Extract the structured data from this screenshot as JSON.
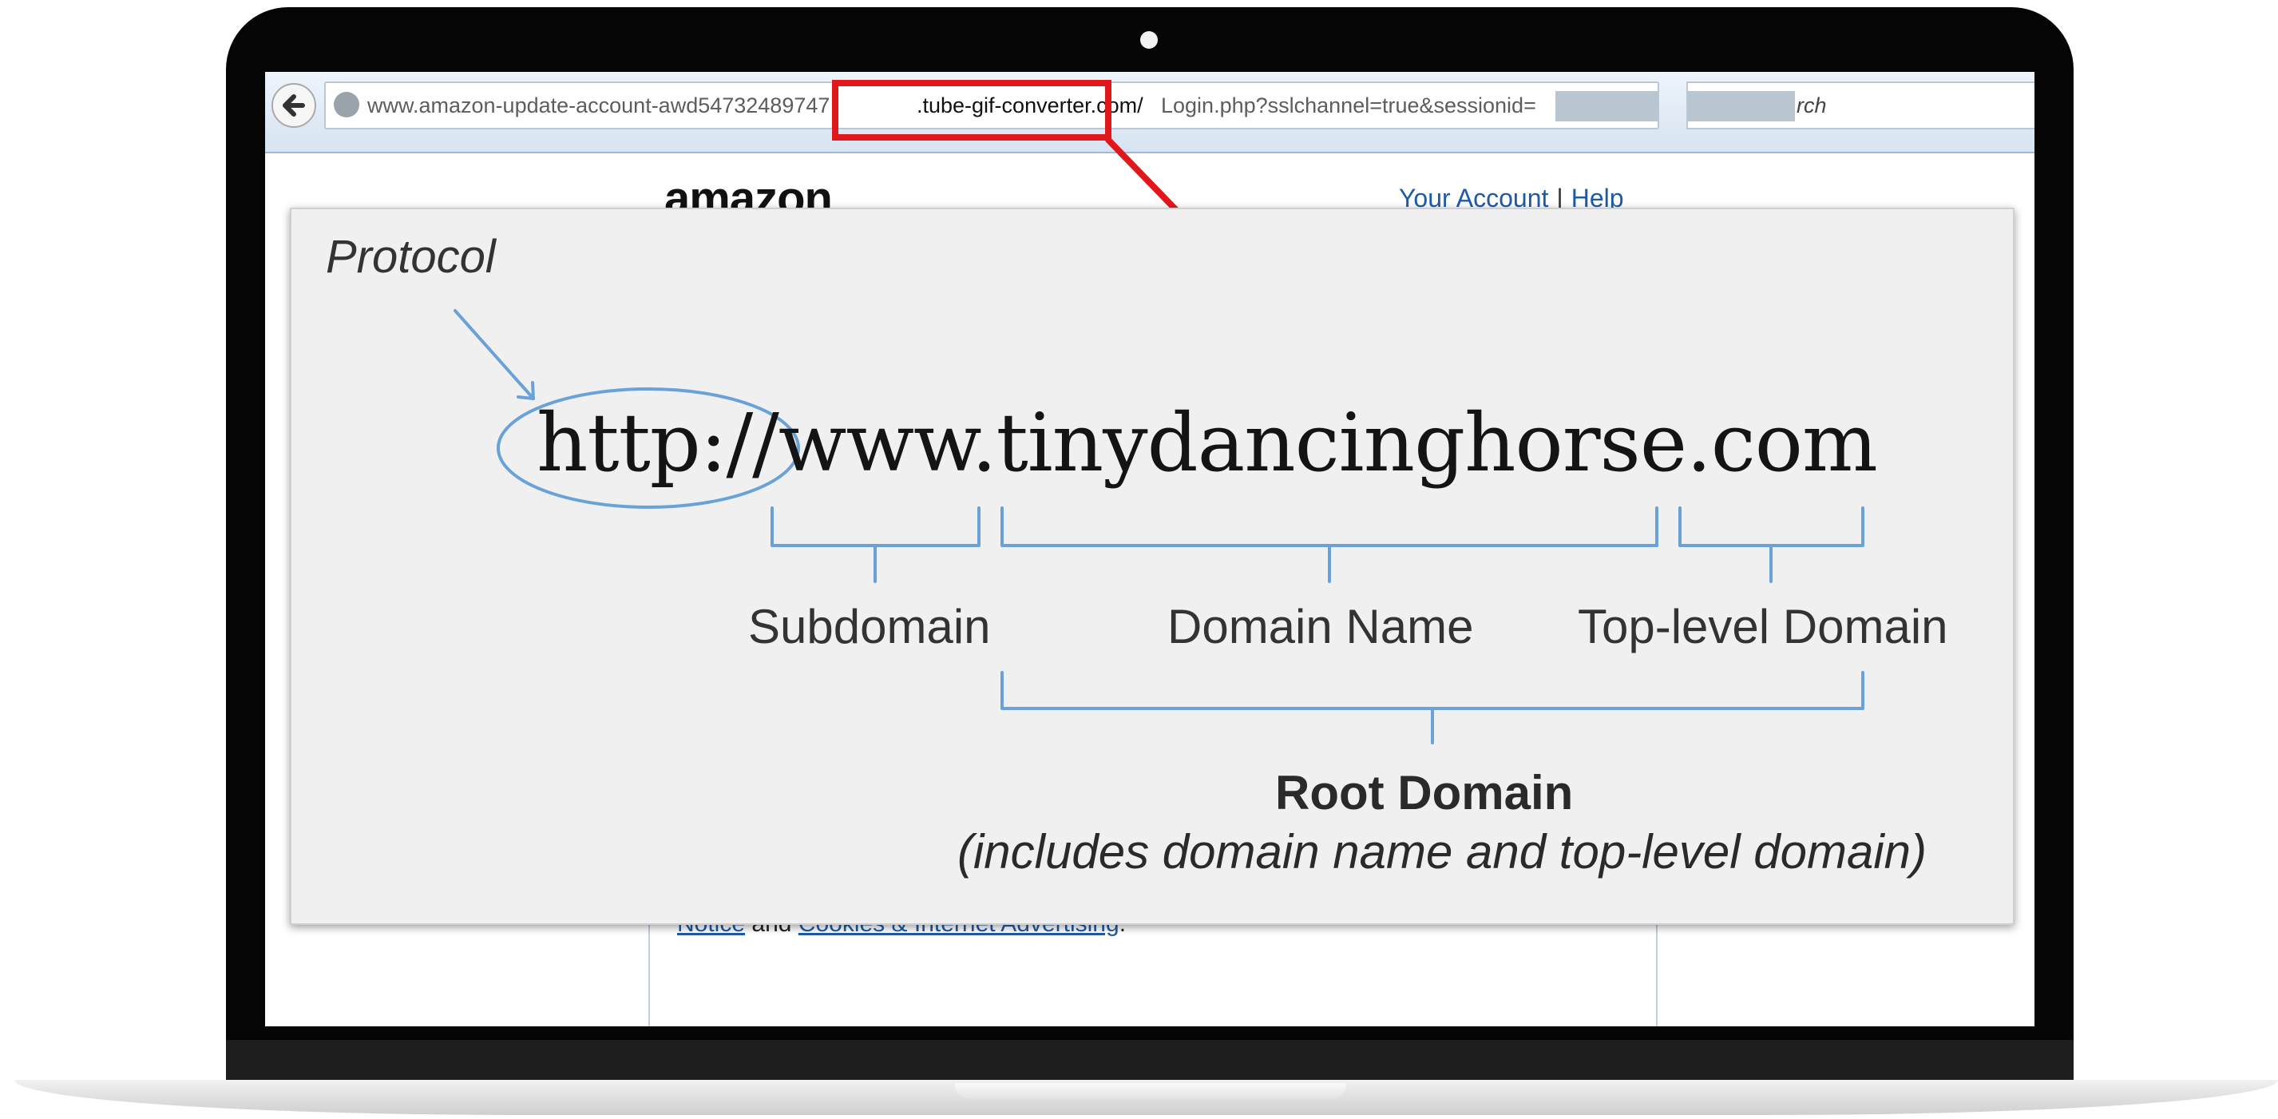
{
  "browser": {
    "url_prefix": "www.amazon-update-account-awd54732489747",
    "url_highlight": ".tube-gif-converter.com/",
    "url_suffix": "Login.php?sslchannel=true&sessionid=",
    "search_text": "rch"
  },
  "page": {
    "logo_text": "amazon",
    "account_link": "Your Account",
    "account_separator": "|",
    "help_link": "Help",
    "privacy_link": "Notice",
    "privacy_and": "and",
    "cookies_link": "Cookies & Internet Advertising",
    "privacy_end": "."
  },
  "diagram": {
    "protocol_label": "Protocol",
    "example_url": "http://www.tinydancinghorse.com",
    "subdomain_label": "Subdomain",
    "domain_name_label": "Domain Name",
    "tld_label": "Top-level Domain",
    "root_domain_label": "Root Domain",
    "root_domain_note": "(includes domain name and top-level domain)"
  },
  "colors": {
    "callout_red": "#e0181b",
    "bracket_blue": "#6aa2d8",
    "link_blue": "#1f5aa6"
  }
}
